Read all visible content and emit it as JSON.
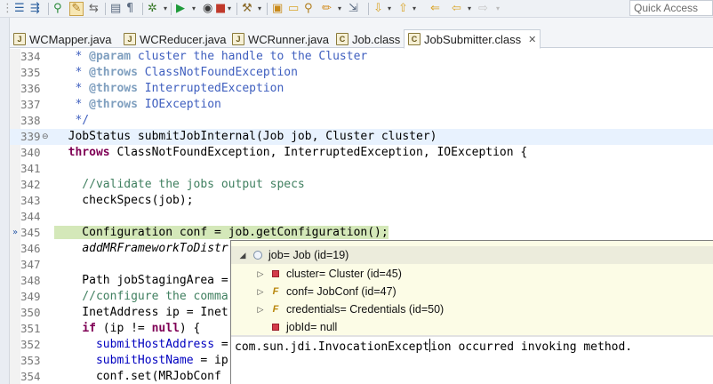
{
  "toolbar": {
    "quick_access_label": "Quick Access",
    "icons": [
      "list-icon",
      "variable-icon",
      "step-over-icon",
      "pen-icon",
      "run-icon",
      "debug-icon",
      "stop-icon",
      "folder-icon",
      "search-icon",
      "pin-icon",
      "back-icon",
      "forward-icon"
    ]
  },
  "tabs": [
    {
      "label": "WCMapper.java",
      "icon_letter": "J"
    },
    {
      "label": "WCReducer.java",
      "icon_letter": "J"
    },
    {
      "label": "WCRunner.java",
      "icon_letter": "J"
    },
    {
      "label": "Job.class",
      "icon_letter": "C"
    },
    {
      "label": "JobSubmitter.class",
      "icon_letter": "C",
      "active": true,
      "close": "✕"
    }
  ],
  "editor": {
    "lines": [
      {
        "n": "334",
        "p1": "   * ",
        "tag": "@param",
        "p2": " cluster the handle to the Cluster"
      },
      {
        "n": "335",
        "p1": "   * ",
        "tag": "@throws",
        "p2": " ClassNotFoundException"
      },
      {
        "n": "336",
        "p1": "   * ",
        "tag": "@throws",
        "p2": " InterruptedException"
      },
      {
        "n": "337",
        "p1": "   * ",
        "tag": "@throws",
        "p2": " IOException"
      },
      {
        "n": "338",
        "p1": "   */"
      },
      {
        "n": "339",
        "text": "  JobStatus submitJobInternal(Job job, Cluster cluster)"
      },
      {
        "n": "340",
        "kw": "throws",
        "text": " ClassNotFoundException, InterruptedException, IOException {"
      },
      {
        "n": "341",
        "text": ""
      },
      {
        "n": "342",
        "lc": "    //validate the jobs output specs"
      },
      {
        "n": "343",
        "text": "    checkSpecs(job);"
      },
      {
        "n": "344",
        "text": ""
      },
      {
        "n": "345",
        "text": "    Configuration conf = job.getConfiguration();"
      },
      {
        "n": "346",
        "text": "    addMRFrameworkToDistr"
      },
      {
        "n": "347",
        "text": ""
      },
      {
        "n": "348",
        "text": "    Path jobStagingArea ="
      },
      {
        "n": "349",
        "lc": "    //configure the comma"
      },
      {
        "n": "350",
        "text": "    InetAddress ip = Inet"
      },
      {
        "n": "351",
        "text": "    if (ip != null) {"
      },
      {
        "n": "352",
        "text": "      submitHostAddress ="
      },
      {
        "n": "353",
        "text": "      submitHostName = ip"
      },
      {
        "n": "354",
        "text": "      conf.set(MRJobConf"
      }
    ],
    "code_345_a": "    Configuration ",
    "code_345_b": "conf",
    "code_345_c": " = ",
    "code_345_d": "job",
    "code_345_e": ".getConfiguration();",
    "code_346_a": "    ",
    "code_346_b": "addMRFrameworkToDistr",
    "code_351_a": "    ",
    "code_351_kw1": "if",
    "code_351_b": " (ip != ",
    "code_351_kw2": "null",
    "code_351_c": ") {",
    "code_352_a": "      ",
    "code_352_b": "submitHostAddress",
    "code_352_c": " =",
    "code_353_a": "      ",
    "code_353_b": "submitHostName",
    "code_353_c": " = ip",
    "code_354_a": "      conf.set(MRJobConf"
  },
  "popup": {
    "root": "job= Job  (id=19)",
    "children": [
      "cluster= Cluster  (id=45)",
      "conf= JobConf  (id=47)",
      "credentials= Credentials  (id=50)",
      "jobId= null"
    ],
    "detail_a": "com.sun.jdi.InvocationExcept",
    "detail_b": "ion occurred invoking method."
  }
}
